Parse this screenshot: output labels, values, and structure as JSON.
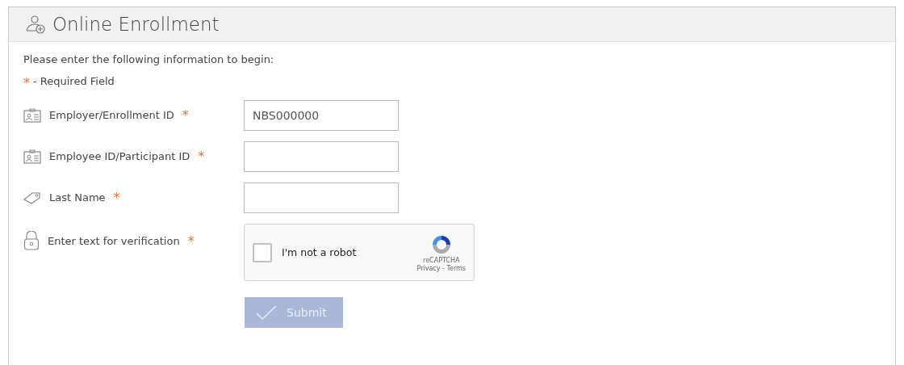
{
  "header": {
    "title": "Online Enrollment"
  },
  "intro": "Please enter the following information to begin:",
  "legend": {
    "mark": "*",
    "text": "- Required Field"
  },
  "fields": [
    {
      "kind": "id-card",
      "label": "Employer/Enrollment ID",
      "mark": "*",
      "value": "NBS000000"
    },
    {
      "kind": "id-card",
      "label": "Employee ID/Participant ID",
      "mark": "*"
    },
    {
      "kind": "tag",
      "label": "Last Name",
      "mark": "*"
    },
    {
      "kind": "captcha",
      "label": "Enter text for verification",
      "mark": "*",
      "captcha": {
        "checked": false,
        "label": "I'm not a robot",
        "brand": "reCAPTCHA",
        "links": "Privacy - Terms"
      }
    }
  ],
  "submit": {
    "label": "Submit",
    "disabled": true
  }
}
